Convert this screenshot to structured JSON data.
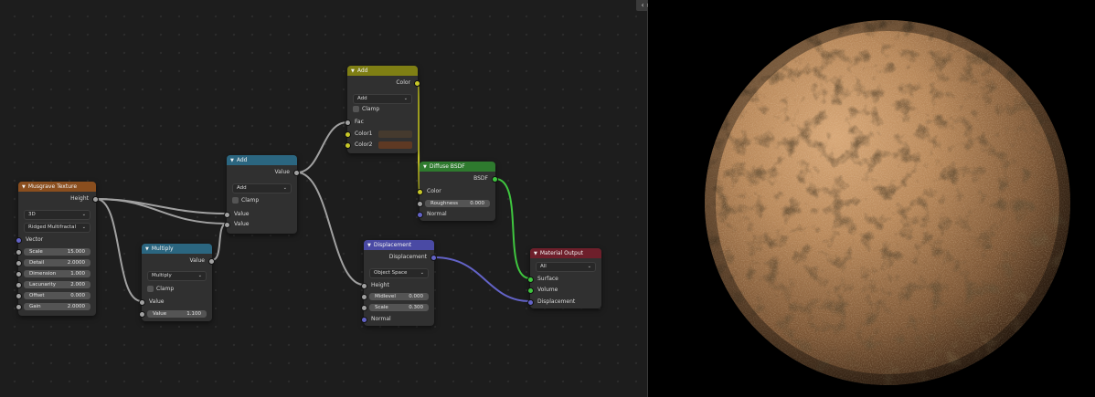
{
  "colors": {
    "editor_background": "#1d1d1d",
    "node_body": "#303030",
    "header_texture": "#8a4e1e",
    "header_converter": "#2b6680",
    "header_color": "#7f7f14",
    "header_shader": "#2e7a2e",
    "header_vector": "#4a4aa4",
    "header_output": "#6e1f2b",
    "socket_float": "#a1a1a1",
    "socket_color": "#c7c729",
    "socket_vector": "#6363c7",
    "socket_shader": "#3fc63f",
    "color1_swatch": "#453a2e",
    "color2_swatch": "#5e3923",
    "material_base": "#b88757"
  },
  "toggle_label": "‹ ›",
  "musgrave": {
    "title": "Musgrave Texture",
    "output_height": "Height",
    "dimensions": "3D",
    "type": "Ridged Multifractal",
    "input_vector": "Vector",
    "fields": [
      {
        "name": "Scale",
        "value": "15.000"
      },
      {
        "name": "Detail",
        "value": "2.0000"
      },
      {
        "name": "Dimension",
        "value": "1.000"
      },
      {
        "name": "Lacunarity",
        "value": "2.000"
      },
      {
        "name": "Offset",
        "value": "0.000"
      },
      {
        "name": "Gain",
        "value": "2.0000"
      }
    ]
  },
  "multiply": {
    "title": "Multiply",
    "output_value": "Value",
    "operation": "Multiply",
    "clamp_label": "Clamp",
    "input_value": "Value",
    "field_name": "Value",
    "field_value": "1.100"
  },
  "add_math": {
    "title": "Add",
    "output_value": "Value",
    "operation": "Add",
    "clamp_label": "Clamp",
    "input_value_1": "Value",
    "input_value_2": "Value"
  },
  "add_mix": {
    "title": "Add",
    "output_color": "Color",
    "blend": "Add",
    "clamp_label": "Clamp",
    "input_fac": "Fac",
    "input_color1": "Color1",
    "input_color2": "Color2"
  },
  "diffuse": {
    "title": "Diffuse BSDF",
    "output_bsdf": "BSDF",
    "input_color": "Color",
    "roughness_name": "Roughness",
    "roughness_value": "0.000",
    "input_normal": "Normal"
  },
  "displacement": {
    "title": "Displacement",
    "output_displacement": "Displacement",
    "space": "Object Space",
    "input_height": "Height",
    "midlevel_name": "Midlevel",
    "midlevel_value": "0.000",
    "scale_name": "Scale",
    "scale_value": "0.300",
    "input_normal": "Normal"
  },
  "material_output": {
    "title": "Material Output",
    "target": "All",
    "input_surface": "Surface",
    "input_volume": "Volume",
    "input_displacement": "Displacement"
  }
}
